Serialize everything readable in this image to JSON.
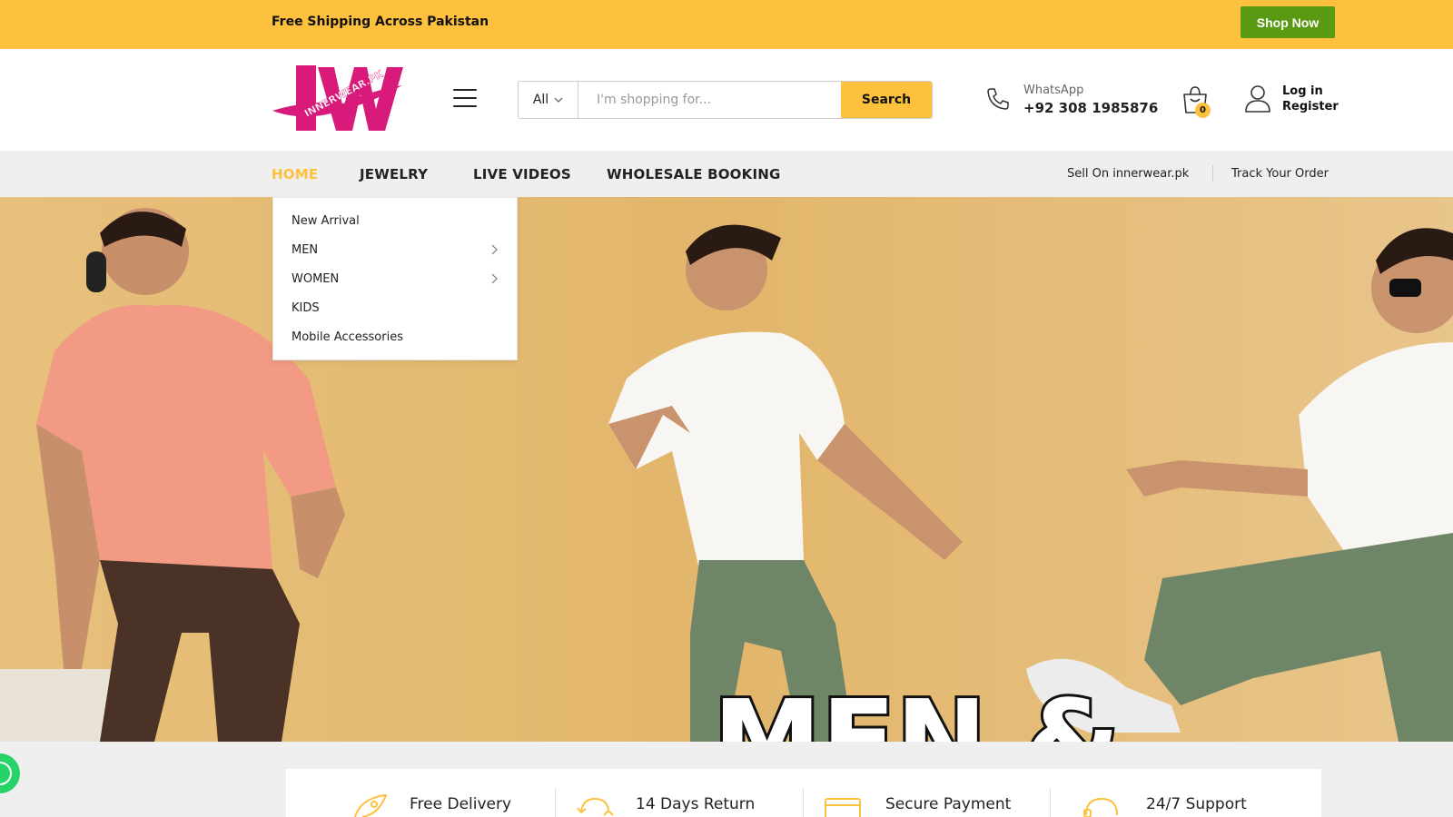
{
  "topbar": {
    "shipping_text": "Free Shipping Across Pakistan",
    "shop_now_label": "Shop Now"
  },
  "header": {
    "logo_text": "INNERWEAR.PK",
    "search": {
      "category": "All",
      "placeholder": "I'm shopping for...",
      "button_label": "Search"
    },
    "whatsapp": {
      "label": "WhatsApp",
      "number": "+92 308 1985876"
    },
    "cart_count": "0",
    "account": {
      "login_label": "Log in",
      "register_label": "Register"
    }
  },
  "nav": {
    "items": [
      "HOME",
      "JEWELRY",
      "LIVE VIDEOS",
      "WHOLESALE BOOKING"
    ],
    "right_links": [
      "Sell On innerwear.pk",
      "Track Your Order"
    ]
  },
  "dropdown": {
    "items": [
      "New Arrival",
      "MEN",
      "WOMEN",
      "KIDS",
      "Mobile Accessories"
    ]
  },
  "hero": {
    "title": "MEN &"
  },
  "features": {
    "items": [
      "Free Delivery",
      "14 Days Return",
      "Secure Payment",
      "24/7 Support"
    ]
  },
  "colors": {
    "accent": "#fec13e",
    "shop_now": "#5a9a12",
    "logo": "#d81b7a",
    "hero_bg": "#e3b96f"
  },
  "icons": [
    "hamburger-icon",
    "chevron-down-icon",
    "phone-icon",
    "cart-icon",
    "user-icon",
    "chevron-right-icon",
    "rocket-icon",
    "return-icon",
    "card-icon",
    "support-icon",
    "whatsapp-icon"
  ]
}
